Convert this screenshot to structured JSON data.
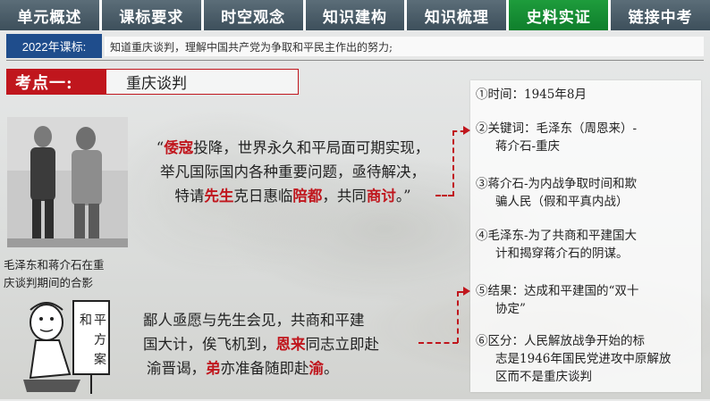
{
  "nav": {
    "tabs": [
      "单元概述",
      "课标要求",
      "时空观念",
      "知识建构",
      "知识梳理",
      "史料实证",
      "链接中考"
    ],
    "active_index": 5,
    "active_color": "#129235",
    "inactive_color": "#46576a"
  },
  "standard": {
    "label": "2022年课标:",
    "text": "知道重庆谈判，理解中国共产党为争取和平民主作出的努力;"
  },
  "kaodian": {
    "label": "考点一:",
    "title": "重庆谈判",
    "accent_color": "#c0161d"
  },
  "photo": {
    "caption_line1": "毛泽东和蒋介石在重",
    "caption_line2": "庆谈判期间的合影"
  },
  "cartoon": {
    "sign_chars": [
      "和",
      "平",
      "方",
      "案"
    ]
  },
  "quote1": {
    "l1_red": "倭寇",
    "l1_rest": "投降，世界永久和平局面可期实现，",
    "l2": "举凡国际国内各种重要问题，亟待解决，",
    "l3_a": "特请",
    "l3_red1": "先生",
    "l3_b": "克日惠临",
    "l3_red2": "陪都",
    "l3_c": "，共同",
    "l3_red3": "商讨",
    "l3_d": "。”",
    "open_quote": "“"
  },
  "quote2": {
    "l1": "鄙人亟愿与先生会见，共商和平建",
    "l2": "国大计，俟飞机到，",
    "l2_red": "恩来",
    "l2_rest": "同志立即赴",
    "l3_a": "渝晋谒，",
    "l3_red1": "弟",
    "l3_b": "亦准备随即赴",
    "l3_red2": "渝",
    "l3_c": "。"
  },
  "points": [
    {
      "line1": "①时间：1945年8月"
    },
    {
      "line1": "②关键词：毛泽东（周恩来）-",
      "line2": "蒋介石-重庆"
    },
    {
      "line1": "③蒋介石-为内战争取时间和欺",
      "line2": "骗人民（假和平真内战）"
    },
    {
      "line1": "④毛泽东-为了共商和平建国大",
      "line2": "计和揭穿蒋介石的阴谋。"
    },
    {
      "line1": "⑤结果：达成和平建国的“双十",
      "line2": "协定”"
    },
    {
      "line1": "⑥区分：人民解放战争开始的标",
      "line2": "志是1946年国民党进攻中原解放",
      "line3": "区而不是重庆谈判"
    }
  ]
}
